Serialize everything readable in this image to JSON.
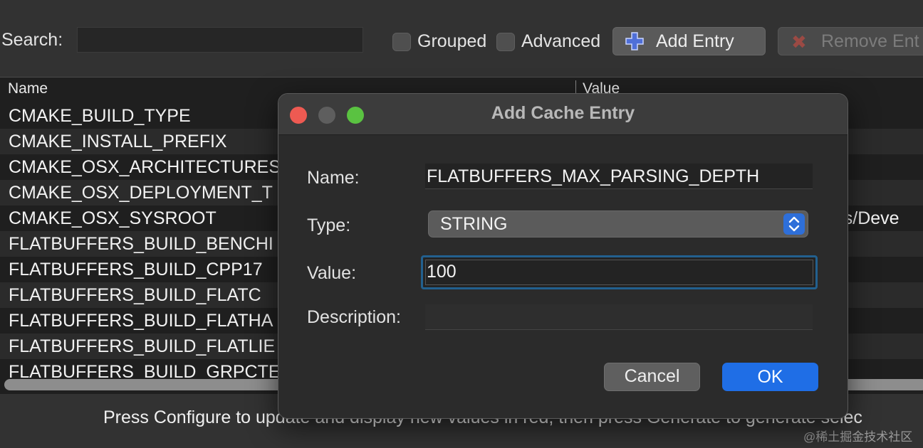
{
  "toolbar": {
    "search_label": "Search:",
    "search_value": "",
    "grouped_label": "Grouped",
    "grouped_checked": false,
    "advanced_label": "Advanced",
    "advanced_checked": false,
    "add_entry_label": "Add Entry",
    "remove_entry_label": "Remove Ent"
  },
  "table": {
    "columns": [
      "Name",
      "Value"
    ],
    "rows": [
      {
        "name": "CMAKE_BUILD_TYPE",
        "value": ""
      },
      {
        "name": "CMAKE_INSTALL_PREFIX",
        "value": ""
      },
      {
        "name": "CMAKE_OSX_ARCHITECTURES",
        "value": ""
      },
      {
        "name": "CMAKE_OSX_DEPLOYMENT_T",
        "value": ""
      },
      {
        "name": "CMAKE_OSX_SYSROOT",
        "value": "ents/Deve"
      },
      {
        "name": "FLATBUFFERS_BUILD_BENCHI",
        "value": ""
      },
      {
        "name": "FLATBUFFERS_BUILD_CPP17",
        "value": ""
      },
      {
        "name": "FLATBUFFERS_BUILD_FLATC",
        "value": ""
      },
      {
        "name": "FLATBUFFERS_BUILD_FLATHA",
        "value": ""
      },
      {
        "name": "FLATBUFFERS_BUILD_FLATLIE",
        "value": ""
      },
      {
        "name": "FLATBUFFERS_BUILD_GRPCTE",
        "value": ""
      }
    ]
  },
  "status_text": "Press Configure to update and display new values in red, then press Generate to generate selec",
  "watermark": "@稀土掘金技术社区",
  "dialog": {
    "title": "Add Cache Entry",
    "name_label": "Name:",
    "name_value": "FLATBUFFERS_MAX_PARSING_DEPTH",
    "type_label": "Type:",
    "type_value": "STRING",
    "value_label": "Value:",
    "value_value": "100",
    "description_label": "Description:",
    "description_value": "",
    "cancel_label": "Cancel",
    "ok_label": "OK"
  },
  "colors": {
    "accent": "#1f6ee6",
    "focus_ring": "#22608f",
    "close": "#ee5a52",
    "maximize": "#5ac241"
  }
}
